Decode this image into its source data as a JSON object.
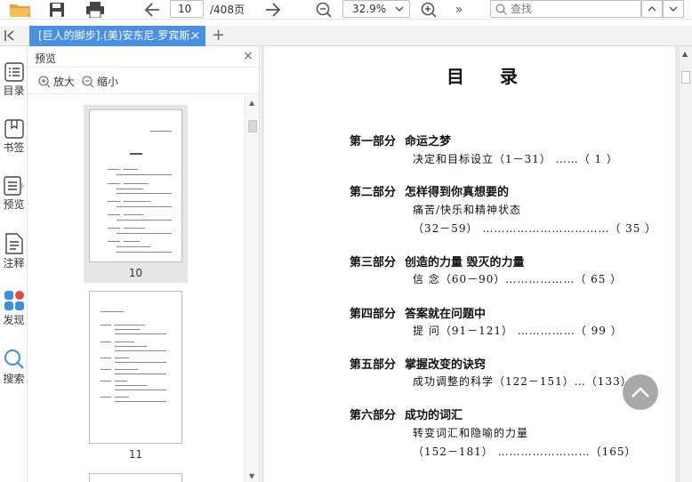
{
  "toolbar": {
    "page_current": "10",
    "page_total": "/408页",
    "zoom": "32.9%",
    "search_placeholder": "查找"
  },
  "tab": {
    "title": "[巨人的脚步].(美)安东尼.罗宾斯.",
    "close": "×",
    "add": "+"
  },
  "leftbar": {
    "items": [
      {
        "label": "目录",
        "icon": "toc-icon"
      },
      {
        "label": "书签",
        "icon": "bookmark-icon"
      },
      {
        "label": "预览",
        "icon": "preview-icon"
      },
      {
        "label": "注释",
        "icon": "annotation-icon"
      },
      {
        "label": "发现",
        "icon": "discover-icon"
      },
      {
        "label": "搜索",
        "icon": "search-icon"
      }
    ]
  },
  "panel": {
    "title": "预览",
    "close": "×",
    "zoom_in": "放大",
    "zoom_out": "缩小",
    "thumbs": [
      {
        "page": "10",
        "selected": true
      },
      {
        "page": "11",
        "selected": false
      }
    ]
  },
  "document": {
    "title": "目录",
    "parts": [
      {
        "part": "第一部分",
        "name": "命运之梦",
        "lines": [
          "决定和目标设立（1－31）  ……（ 1 ）"
        ]
      },
      {
        "part": "第二部分",
        "name": "怎样得到你真想要的",
        "lines": [
          "痛苦/快乐和精神状态",
          "（32－59）  ……………………………（ 35 ）"
        ]
      },
      {
        "part": "第三部分",
        "name": "创造的力量  毁灭的力量",
        "lines": [
          "信  念（60－90）………………（ 65 ）"
        ]
      },
      {
        "part": "第四部分",
        "name": "答案就在问题中",
        "lines": [
          "提  问（91－121）  ……………（ 99 ）"
        ]
      },
      {
        "part": "第五部分",
        "name": "掌握改变的诀窍",
        "lines": [
          "成功调整的科学（122－151）…（133）"
        ]
      },
      {
        "part": "第六部分",
        "name": "成功的词汇",
        "lines": [
          "转变词汇和隐喻的力量",
          "（152－181）  ……………………（165）"
        ]
      }
    ]
  },
  "colors": {
    "tab_active": "#4a90e2",
    "fab": "#a8a8a8",
    "accent_icon": "#e9a23b",
    "discover_blue": "#3d8fe0",
    "discover_red": "#e8453c"
  }
}
